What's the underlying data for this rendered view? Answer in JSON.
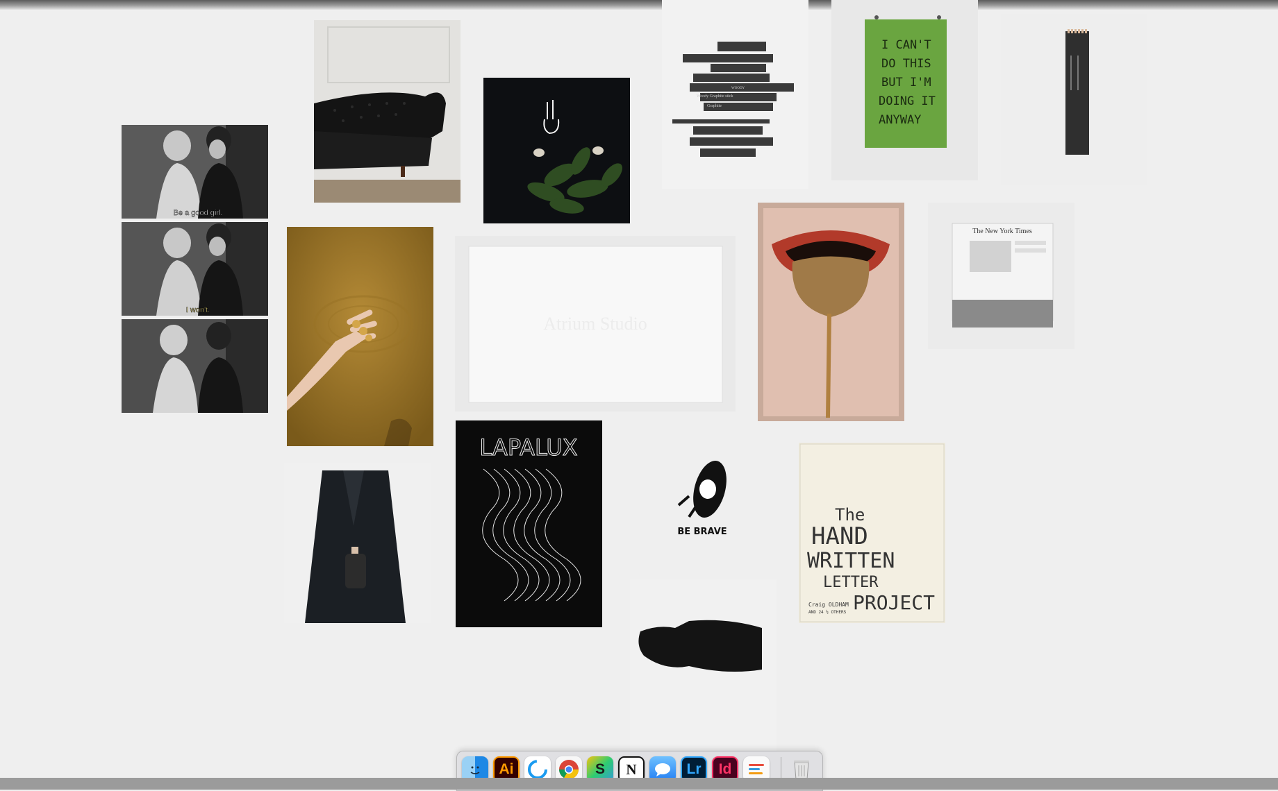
{
  "moodboard": {
    "captions": {
      "frame1": "Be a good girl.",
      "frame2": "I won't."
    },
    "green_poster_lines": [
      "I CAN'T",
      "DO THIS",
      "BUT I'M",
      "DOING IT",
      "ANYWAY"
    ],
    "graphite_labels": [
      "Graphite",
      "Woody Graphite stick",
      "WOODY"
    ],
    "card_text": "Atrium Studio",
    "newspaper_masthead": "The New York Times",
    "lapalux_word": "LAPALUX",
    "be_brave_text": "BE BRAVE",
    "book": {
      "line1": "The",
      "line2": "HAND",
      "line3": "WRITTEN",
      "line4": "LETTER",
      "line5": "PROJECT",
      "author1": "Craig OLDHAM",
      "author2": "AND 24 ½ OTHERS"
    }
  },
  "dock": {
    "apps": [
      {
        "label": "",
        "icon": "finder-icon",
        "color": "#1e88e5"
      },
      {
        "label": "Ai",
        "icon": "illustrator-icon",
        "color": "#300000"
      },
      {
        "label": "",
        "icon": "sync-app-icon",
        "color": "#ffffff"
      },
      {
        "label": "",
        "icon": "chrome-icon",
        "color": "#ffffff"
      },
      {
        "label": "S",
        "icon": "sheets-app-icon",
        "color": "#ffffff"
      },
      {
        "label": "N",
        "icon": "notion-icon",
        "color": "#ffffff"
      },
      {
        "label": "",
        "icon": "messages-icon",
        "color": "#ffffff"
      },
      {
        "label": "Lr",
        "icon": "lightroom-icon",
        "color": "#001e36"
      },
      {
        "label": "Id",
        "icon": "indesign-icon",
        "color": "#49021f"
      },
      {
        "label": "",
        "icon": "notes-app-icon",
        "color": "#ffffff"
      },
      {
        "label": "",
        "icon": "trash-icon",
        "color": "#ffffff"
      }
    ]
  }
}
